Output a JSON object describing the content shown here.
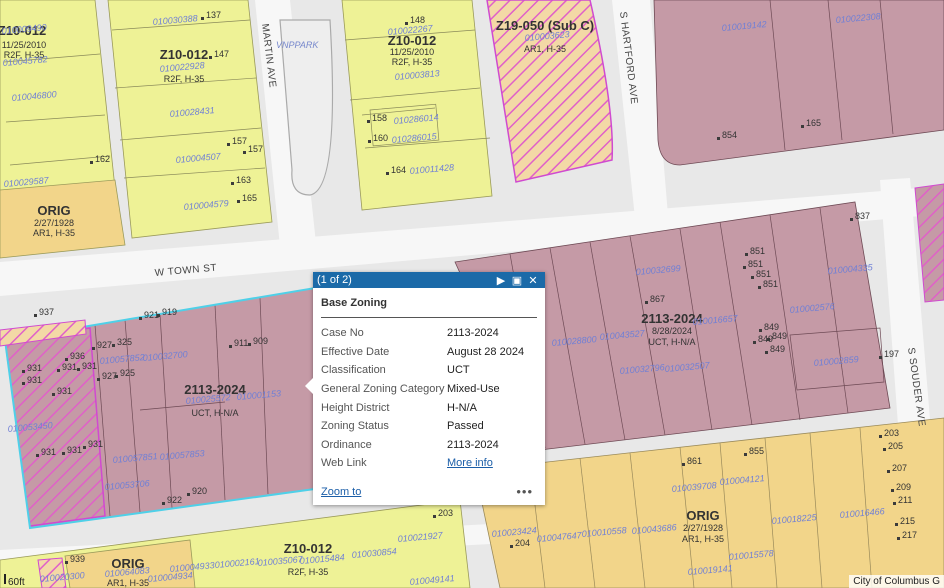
{
  "map": {
    "streets": {
      "w_town": "W TOWN ST",
      "martin": "MARTIN AVE",
      "s_hartford": "S HARTFORD AVE",
      "s_souder": "S SOUDER AVE",
      "park": "VNPPARK"
    },
    "zones": {
      "z10_a": {
        "code": "Z10-012",
        "date": "11/25/2010",
        "sub": "R2F, H-35"
      },
      "z10_b": {
        "code": "Z10-012",
        "sub": "R2F, H-35"
      },
      "z10_c": {
        "code": "Z10-012",
        "date": "11/25/2010",
        "sub": "R2F, H-35"
      },
      "z10_d": {
        "code": "Z10-012",
        "sub": "R2F, H-35"
      },
      "z19": {
        "code": "Z19-050 (Sub C)",
        "sub": "AR1, H-35"
      },
      "orig_a": {
        "code": "ORIG",
        "date": "2/27/1928",
        "sub": "AR1, H-35"
      },
      "orig_b": {
        "code": "ORIG",
        "date": "2/27/1928",
        "sub": "AR1, H-35"
      },
      "orig_c": {
        "code": "ORIG",
        "sub": "AR1, H-35"
      },
      "uct_a": {
        "code": "2113-2024",
        "sub": "UCT, H-N/A"
      },
      "uct_b": {
        "code": "2113-2024",
        "date": "8/28/2024",
        "sub": "UCT, H-N/A"
      }
    },
    "parcels": [
      "010009490",
      "010045782",
      "010046800",
      "010029587",
      "010030388",
      "010022928",
      "010028431",
      "010004507",
      "010004579",
      "010022267",
      "010003813",
      "010286014",
      "010286015",
      "010011428",
      "010003623",
      "010019142",
      "010022308",
      "010032699",
      "010004335",
      "010002576",
      "010002859",
      "010016657",
      "010043527",
      "010028800",
      "010032796",
      "010032507",
      "010057852",
      "010032700",
      "010025572",
      "010001153",
      "010053450",
      "010057851",
      "010057853",
      "010053706",
      "010039708",
      "010004121",
      "010043686",
      "010016466",
      "010018225",
      "010023424",
      "010047647",
      "010010558",
      "010015578",
      "010019141",
      "010064083",
      "010004934",
      "010004933",
      "010020300",
      "010002161",
      "010035067",
      "010015484",
      "010030854",
      "010021927",
      "010049141"
    ],
    "addresses": [
      "137",
      "147",
      "162",
      "157",
      "157",
      "163",
      "165",
      "148",
      "158",
      "160",
      "164",
      "854",
      "165",
      "837",
      "851",
      "851",
      "851",
      "851",
      "867",
      "849",
      "849",
      "849",
      "849",
      "197",
      "937",
      "921",
      "919",
      "911",
      "909",
      "927",
      "325",
      "936",
      "931",
      "931",
      "931",
      "927",
      "925",
      "931",
      "931",
      "931",
      "931",
      "931",
      "922",
      "920",
      "861",
      "855",
      "203",
      "205",
      "207",
      "209",
      "211",
      "215",
      "217",
      "204",
      "203",
      "939"
    ]
  },
  "popup": {
    "counter": "(1 of 2)",
    "title": "Base Zoning",
    "rows": [
      {
        "label": "Case No",
        "value": "2113-2024"
      },
      {
        "label": "Effective Date",
        "value": "August 28 2024"
      },
      {
        "label": "Classification",
        "value": "UCT"
      },
      {
        "label": "General Zoning Category",
        "value": "Mixed-Use"
      },
      {
        "label": "Height District",
        "value": "H-N/A"
      },
      {
        "label": "Zoning Status",
        "value": "Passed"
      },
      {
        "label": "Ordinance",
        "value": "2113-2024"
      },
      {
        "label": "Web Link",
        "value": "More info"
      }
    ],
    "zoom_to": "Zoom to",
    "more": "•••"
  },
  "scale": "60ft",
  "attribution": "City of Columbus G",
  "colors": {
    "yellow_zone": "#eef296",
    "orange_zone": "#f2d58a",
    "maroon_zone": "#c59aa6",
    "hatch_pink": "#e060c8",
    "popup_header": "#1b6aa8",
    "selection": "#4fd0e8"
  }
}
